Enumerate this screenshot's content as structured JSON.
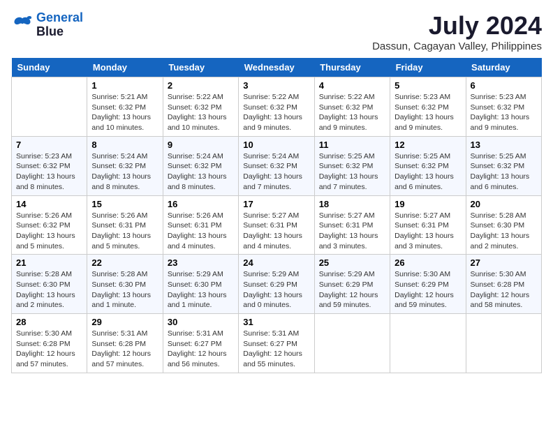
{
  "logo": {
    "line1": "General",
    "line2": "Blue"
  },
  "title": "July 2024",
  "subtitle": "Dassun, Cagayan Valley, Philippines",
  "days": [
    "Sunday",
    "Monday",
    "Tuesday",
    "Wednesday",
    "Thursday",
    "Friday",
    "Saturday"
  ],
  "weeks": [
    [
      {
        "date": "",
        "sunrise": "",
        "sunset": "",
        "daylight": ""
      },
      {
        "date": "1",
        "sunrise": "Sunrise: 5:21 AM",
        "sunset": "Sunset: 6:32 PM",
        "daylight": "Daylight: 13 hours and 10 minutes."
      },
      {
        "date": "2",
        "sunrise": "Sunrise: 5:22 AM",
        "sunset": "Sunset: 6:32 PM",
        "daylight": "Daylight: 13 hours and 10 minutes."
      },
      {
        "date": "3",
        "sunrise": "Sunrise: 5:22 AM",
        "sunset": "Sunset: 6:32 PM",
        "daylight": "Daylight: 13 hours and 9 minutes."
      },
      {
        "date": "4",
        "sunrise": "Sunrise: 5:22 AM",
        "sunset": "Sunset: 6:32 PM",
        "daylight": "Daylight: 13 hours and 9 minutes."
      },
      {
        "date": "5",
        "sunrise": "Sunrise: 5:23 AM",
        "sunset": "Sunset: 6:32 PM",
        "daylight": "Daylight: 13 hours and 9 minutes."
      },
      {
        "date": "6",
        "sunrise": "Sunrise: 5:23 AM",
        "sunset": "Sunset: 6:32 PM",
        "daylight": "Daylight: 13 hours and 9 minutes."
      }
    ],
    [
      {
        "date": "7",
        "sunrise": "Sunrise: 5:23 AM",
        "sunset": "Sunset: 6:32 PM",
        "daylight": "Daylight: 13 hours and 8 minutes."
      },
      {
        "date": "8",
        "sunrise": "Sunrise: 5:24 AM",
        "sunset": "Sunset: 6:32 PM",
        "daylight": "Daylight: 13 hours and 8 minutes."
      },
      {
        "date": "9",
        "sunrise": "Sunrise: 5:24 AM",
        "sunset": "Sunset: 6:32 PM",
        "daylight": "Daylight: 13 hours and 8 minutes."
      },
      {
        "date": "10",
        "sunrise": "Sunrise: 5:24 AM",
        "sunset": "Sunset: 6:32 PM",
        "daylight": "Daylight: 13 hours and 7 minutes."
      },
      {
        "date": "11",
        "sunrise": "Sunrise: 5:25 AM",
        "sunset": "Sunset: 6:32 PM",
        "daylight": "Daylight: 13 hours and 7 minutes."
      },
      {
        "date": "12",
        "sunrise": "Sunrise: 5:25 AM",
        "sunset": "Sunset: 6:32 PM",
        "daylight": "Daylight: 13 hours and 6 minutes."
      },
      {
        "date": "13",
        "sunrise": "Sunrise: 5:25 AM",
        "sunset": "Sunset: 6:32 PM",
        "daylight": "Daylight: 13 hours and 6 minutes."
      }
    ],
    [
      {
        "date": "14",
        "sunrise": "Sunrise: 5:26 AM",
        "sunset": "Sunset: 6:32 PM",
        "daylight": "Daylight: 13 hours and 5 minutes."
      },
      {
        "date": "15",
        "sunrise": "Sunrise: 5:26 AM",
        "sunset": "Sunset: 6:31 PM",
        "daylight": "Daylight: 13 hours and 5 minutes."
      },
      {
        "date": "16",
        "sunrise": "Sunrise: 5:26 AM",
        "sunset": "Sunset: 6:31 PM",
        "daylight": "Daylight: 13 hours and 4 minutes."
      },
      {
        "date": "17",
        "sunrise": "Sunrise: 5:27 AM",
        "sunset": "Sunset: 6:31 PM",
        "daylight": "Daylight: 13 hours and 4 minutes."
      },
      {
        "date": "18",
        "sunrise": "Sunrise: 5:27 AM",
        "sunset": "Sunset: 6:31 PM",
        "daylight": "Daylight: 13 hours and 3 minutes."
      },
      {
        "date": "19",
        "sunrise": "Sunrise: 5:27 AM",
        "sunset": "Sunset: 6:31 PM",
        "daylight": "Daylight: 13 hours and 3 minutes."
      },
      {
        "date": "20",
        "sunrise": "Sunrise: 5:28 AM",
        "sunset": "Sunset: 6:30 PM",
        "daylight": "Daylight: 13 hours and 2 minutes."
      }
    ],
    [
      {
        "date": "21",
        "sunrise": "Sunrise: 5:28 AM",
        "sunset": "Sunset: 6:30 PM",
        "daylight": "Daylight: 13 hours and 2 minutes."
      },
      {
        "date": "22",
        "sunrise": "Sunrise: 5:28 AM",
        "sunset": "Sunset: 6:30 PM",
        "daylight": "Daylight: 13 hours and 1 minute."
      },
      {
        "date": "23",
        "sunrise": "Sunrise: 5:29 AM",
        "sunset": "Sunset: 6:30 PM",
        "daylight": "Daylight: 13 hours and 1 minute."
      },
      {
        "date": "24",
        "sunrise": "Sunrise: 5:29 AM",
        "sunset": "Sunset: 6:29 PM",
        "daylight": "Daylight: 13 hours and 0 minutes."
      },
      {
        "date": "25",
        "sunrise": "Sunrise: 5:29 AM",
        "sunset": "Sunset: 6:29 PM",
        "daylight": "Daylight: 12 hours and 59 minutes."
      },
      {
        "date": "26",
        "sunrise": "Sunrise: 5:30 AM",
        "sunset": "Sunset: 6:29 PM",
        "daylight": "Daylight: 12 hours and 59 minutes."
      },
      {
        "date": "27",
        "sunrise": "Sunrise: 5:30 AM",
        "sunset": "Sunset: 6:28 PM",
        "daylight": "Daylight: 12 hours and 58 minutes."
      }
    ],
    [
      {
        "date": "28",
        "sunrise": "Sunrise: 5:30 AM",
        "sunset": "Sunset: 6:28 PM",
        "daylight": "Daylight: 12 hours and 57 minutes."
      },
      {
        "date": "29",
        "sunrise": "Sunrise: 5:31 AM",
        "sunset": "Sunset: 6:28 PM",
        "daylight": "Daylight: 12 hours and 57 minutes."
      },
      {
        "date": "30",
        "sunrise": "Sunrise: 5:31 AM",
        "sunset": "Sunset: 6:27 PM",
        "daylight": "Daylight: 12 hours and 56 minutes."
      },
      {
        "date": "31",
        "sunrise": "Sunrise: 5:31 AM",
        "sunset": "Sunset: 6:27 PM",
        "daylight": "Daylight: 12 hours and 55 minutes."
      },
      {
        "date": "",
        "sunrise": "",
        "sunset": "",
        "daylight": ""
      },
      {
        "date": "",
        "sunrise": "",
        "sunset": "",
        "daylight": ""
      },
      {
        "date": "",
        "sunrise": "",
        "sunset": "",
        "daylight": ""
      }
    ]
  ]
}
